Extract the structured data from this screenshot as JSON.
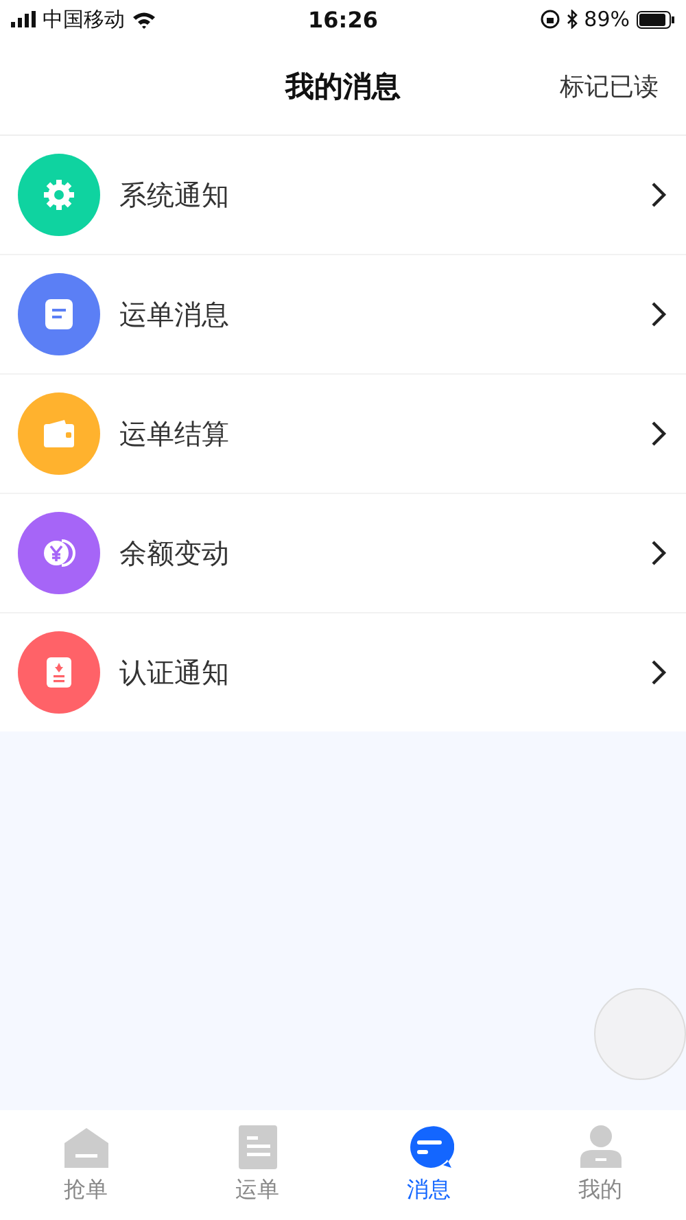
{
  "status_bar": {
    "carrier": "中国移动",
    "time": "16:26",
    "battery": "89%"
  },
  "nav": {
    "title": "我的消息",
    "action": "标记已读"
  },
  "items": [
    {
      "label": "系统通知",
      "kind": "gear",
      "color": "#0fd3a0"
    },
    {
      "label": "运单消息",
      "kind": "doc",
      "color": "#5b7ff5"
    },
    {
      "label": "运单结算",
      "kind": "wallet",
      "color": "#ffb22e"
    },
    {
      "label": "余额变动",
      "kind": "coin",
      "color": "#a665f7"
    },
    {
      "label": "认证通知",
      "kind": "badge",
      "color": "#ff6268"
    }
  ],
  "tabs": [
    {
      "label": "抢单",
      "kind": "home",
      "selected": false
    },
    {
      "label": "运单",
      "kind": "list",
      "selected": false
    },
    {
      "label": "消息",
      "kind": "chat",
      "selected": true
    },
    {
      "label": "我的",
      "kind": "person",
      "selected": false
    }
  ]
}
